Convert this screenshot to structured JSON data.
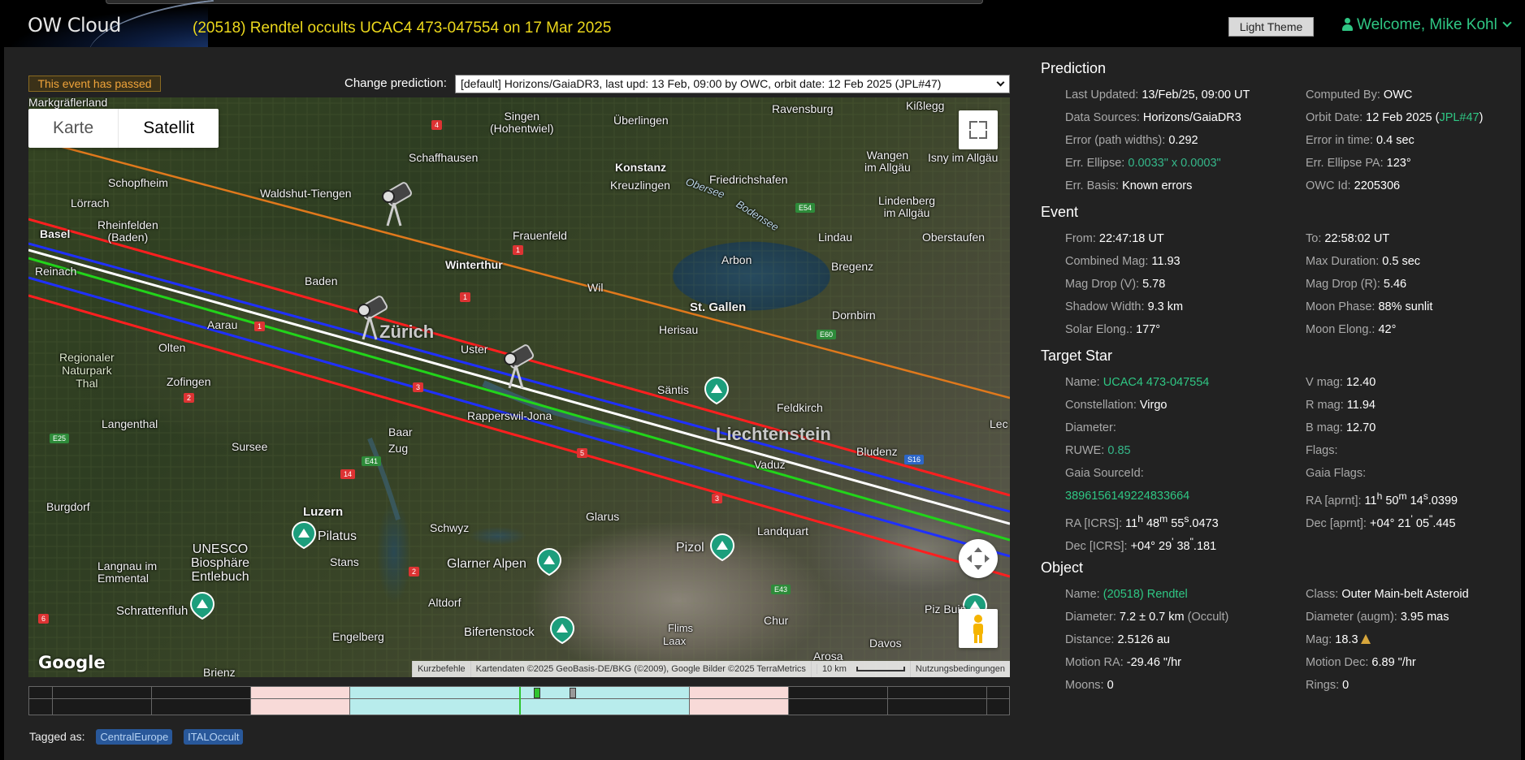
{
  "header": {
    "logo": "OW Cloud",
    "event_title": "(20518) Rendtel occults UCAC4 473-047554 on 17 Mar 2025",
    "theme_button": "Light Theme",
    "welcome": "Welcome, Mike Kohl"
  },
  "controls": {
    "passed_badge": "This event has passed",
    "change_label": "Change prediction:",
    "prediction_selected": "[default] Horizons/GaiaDR3, last upd: 13 Feb, 09:00 by OWC, orbit date: 12 Feb 2025 (JPL#47)"
  },
  "map": {
    "toggle": [
      "Karte",
      "Satellit"
    ],
    "google": "Google",
    "footer": {
      "shortcuts": "Kurzbefehle",
      "attribution": "Kartendaten ©2025 GeoBasis-DE/BKG (©2009), Google Bilder ©2025 TerraMetrics",
      "scale": "10 km",
      "terms": "Nutzungsbedingungen"
    },
    "labels": {
      "markgraeflerland": "Markgräflerland",
      "singen": "Singen\n(Hohentwiel)",
      "ueberlingen": "Überlingen",
      "ravensburg": "Ravensburg",
      "kisslegg": "Kißlegg",
      "schaffhausen": "Schaffhausen",
      "konstanz": "Konstanz",
      "kreuzlingen": "Kreuzlingen",
      "friedrichshafen": "Friedrichshafen",
      "wangen": "Wangen\nim Allgäu",
      "isny": "Isny im Allgäu",
      "schopfheim": "Schopfheim",
      "loerrach": "Lörrach",
      "waldshut": "Waldshut-Tiengen",
      "rheinfelden": "Rheinfelden\n(Baden)",
      "obersee": "Obersee",
      "bodensee": "Bodensee",
      "lindenberg": "Lindenberg\nim Allgäu",
      "basel": "Basel",
      "frauenfeld": "Frauenfeld",
      "lindau": "Lindau",
      "oberstaufen": "Oberstaufen",
      "reinach": "Reinach",
      "winterthur": "Winterthur",
      "arbon": "Arbon",
      "bregenz": "Bregenz",
      "baden": "Baden",
      "wil": "Wil",
      "st_gallen": "St. Gallen",
      "dornbirn": "Dornbirn",
      "aarau": "Aarau",
      "zuerich": "Zürich",
      "uster": "Uster",
      "herisau": "Herisau",
      "olten": "Olten",
      "regionaler": "Regionaler\nNaturpark\nThal",
      "zofingen": "Zofingen",
      "saentis": "Säntis",
      "feldkirch": "Feldkirch",
      "langenthal": "Langenthal",
      "rapperswil": "Rapperswil-Jona",
      "liechtenstein": "Liechtenstein",
      "lec": "Lec",
      "baar": "Baar",
      "sursee": "Sursee",
      "zug": "Zug",
      "bludenz": "Bludenz",
      "vaduz": "Vaduz",
      "burgdorf": "Burgdorf",
      "luzern": "Luzern",
      "glarus": "Glarus",
      "schwyz": "Schwyz",
      "pilatus": "Pilatus",
      "stans": "Stans",
      "glarner_alpen": "Glarner Alpen",
      "pizol": "Pizol",
      "landquart": "Landquart",
      "unesco": "UNESCO\nBiosphäre\nEntlebuch",
      "langnau": "Langnau im\nEmmental",
      "schrattenfluh": "Schrattenfluh",
      "altdorf": "Altdorf",
      "chur": "Chur",
      "piz_buin": "Piz Buin",
      "flims": "Flims",
      "laax": "Laax",
      "engelberg": "Engelberg",
      "bifertenstock": "Bifertenstock",
      "arosa": "Arosa",
      "davos": "Davos",
      "brienz": "Brienz"
    },
    "roads": {
      "r4": "4",
      "r1a": "1",
      "r1b": "1",
      "r1c": "1",
      "r2a": "2",
      "r2b": "2",
      "r3": "3",
      "r5": "5",
      "r6": "6",
      "r14": "14",
      "e25": "E25",
      "e41": "E41",
      "e54": "E54",
      "e60": "E60",
      "e43": "E43",
      "s16": "S16",
      "a3": "3"
    },
    "line_colors": {
      "orange": "#e0791c",
      "red": "#ff1f1f",
      "blue": "#1f30ff",
      "green": "#22d41a",
      "white": "#ffffff"
    }
  },
  "timeline": {
    "colors": {
      "pink": "#f8dad8",
      "cyan": "#b8ecec"
    }
  },
  "tags": {
    "label": "Tagged as:",
    "items": [
      "CentralEurope",
      "ITALOccult"
    ]
  },
  "prediction": {
    "title": "Prediction",
    "last_updated_l": "Last Updated:",
    "last_updated_v": "13/Feb/25, 09:00 UT",
    "computed_by_l": "Computed By:",
    "computed_by_v": "OWC",
    "data_sources_l": "Data Sources:",
    "data_sources_v": "Horizons/GaiaDR3",
    "orbit_date_l": "Orbit Date:",
    "orbit_date_v": "12 Feb 2025 (",
    "orbit_date_link": "JPL#47",
    "orbit_date_end": ")",
    "error_widths_l": "Error (path widths):",
    "error_widths_v": "0.292",
    "error_time_l": "Error in time:",
    "error_time_v": "0.4 sec",
    "err_ellipse_l": "Err. Ellipse:",
    "err_ellipse_v": "0.0033\" x 0.0003\"",
    "err_ellipse_pa_l": "Err. Ellipse PA:",
    "err_ellipse_pa_v": "123°",
    "err_basis_l": "Err. Basis:",
    "err_basis_v": "Known errors",
    "owc_id_l": "OWC Id:",
    "owc_id_v": "2205306"
  },
  "event": {
    "title": "Event",
    "from_l": "From:",
    "from_v": "22:47:18 UT",
    "to_l": "To:",
    "to_v": "22:58:02 UT",
    "combined_mag_l": "Combined Mag:",
    "combined_mag_v": "11.93",
    "max_duration_l": "Max Duration:",
    "max_duration_v": "0.5 sec",
    "mag_drop_v_l": "Mag Drop (V):",
    "mag_drop_v_v": "5.78",
    "mag_drop_r_l": "Mag Drop (R):",
    "mag_drop_r_v": "5.46",
    "shadow_width_l": "Shadow Width:",
    "shadow_width_v": "9.3 km",
    "moon_phase_l": "Moon Phase:",
    "moon_phase_v": "88% sunlit",
    "solar_elong_l": "Solar Elong.:",
    "solar_elong_v": "177°",
    "moon_elong_l": "Moon Elong.:",
    "moon_elong_v": "42°"
  },
  "target_star": {
    "title": "Target Star",
    "name_l": "Name:",
    "name_v": "UCAC4 473-047554",
    "vmag_l": "V mag:",
    "vmag_v": "12.40",
    "constellation_l": "Constellation:",
    "constellation_v": "Virgo",
    "rmag_l": "R mag:",
    "rmag_v": "11.94",
    "diameter_l": "Diameter:",
    "bmag_l": "B mag:",
    "bmag_v": "12.70",
    "ruwe_l": "RUWE:",
    "ruwe_v": "0.85",
    "flags_l": "Flags:",
    "gaia_source_l": "Gaia SourceId:",
    "gaia_flags_l": "Gaia Flags:",
    "gaia_source_v": "3896156149224833664",
    "ra_aprnt_l": "RA [aprnt]:",
    "ra_aprnt_h": "11",
    "ra_aprnt_m": "50",
    "ra_aprnt_s": "14",
    "ra_aprnt_frac": ".0399",
    "ra_icrs_l": "RA [ICRS]:",
    "ra_icrs_h": "11",
    "ra_icrs_m": "48",
    "ra_icrs_s": "55",
    "ra_icrs_frac": ".0473",
    "dec_aprnt_l": "Dec [aprnt]:",
    "dec_aprnt_d": "+04° 21",
    "dec_aprnt_m": "05",
    "dec_aprnt_frac": ".445",
    "dec_icrs_l": "Dec [ICRS]:",
    "dec_icrs_d": "+04° 29",
    "dec_icrs_m": "38",
    "dec_icrs_frac": ".181"
  },
  "object": {
    "title": "Object",
    "name_l": "Name:",
    "name_v": "(20518) Rendtel",
    "class_l": "Class:",
    "class_v": "Outer Main-belt Asteroid",
    "diameter_l": "Diameter:",
    "diameter_v": "7.2 ± 0.7 km",
    "diameter_src": "(Occult)",
    "diameter_augm_l": "Diameter (augm):",
    "diameter_augm_v": "3.95 mas",
    "distance_l": "Distance:",
    "distance_v": "2.5126 au",
    "mag_l": "Mag:",
    "mag_v": "18.3",
    "motion_ra_l": "Motion RA:",
    "motion_ra_v": "-29.46 \"/hr",
    "motion_dec_l": "Motion Dec:",
    "motion_dec_v": "6.89 \"/hr",
    "moons_l": "Moons:",
    "moons_v": "0",
    "rings_l": "Rings:",
    "rings_v": "0"
  }
}
